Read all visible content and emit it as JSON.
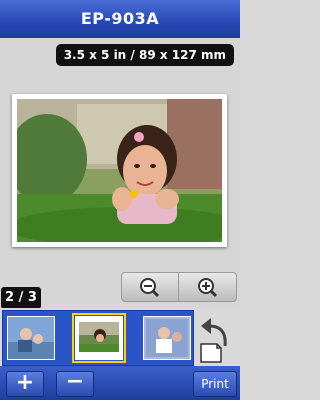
{
  "header": {
    "title": "EP-903A"
  },
  "preview": {
    "paper_size": "3.5 x 5 in / 89 x 127 mm",
    "zoom_out_icon": "zoom-out-icon",
    "zoom_in_icon": "zoom-in-icon"
  },
  "pager": {
    "label": "2 / 3"
  },
  "toolbar": {
    "add_label": "+",
    "remove_label": "−",
    "print_label": "Print"
  },
  "colors": {
    "title_bar": "#2747b4",
    "strip": "#2a55c8",
    "selection": "#ffd200"
  }
}
